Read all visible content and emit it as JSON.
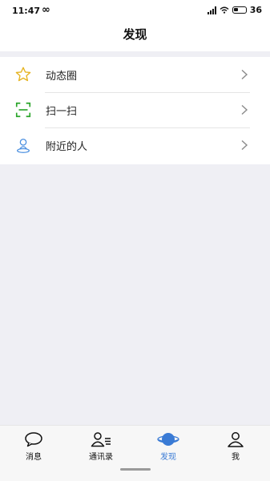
{
  "status_bar": {
    "time": "11:47",
    "link_icon": "infinity-icon",
    "battery": "36"
  },
  "header": {
    "title": "发现"
  },
  "menu": {
    "items": [
      {
        "label": "动态圈",
        "icon": "star-icon",
        "icon_color": "#e6b422"
      },
      {
        "label": "扫一扫",
        "icon": "scan-icon",
        "icon_color": "#2aa52a"
      },
      {
        "label": "附近的人",
        "icon": "person-location-icon",
        "icon_color": "#4a8fe0"
      }
    ]
  },
  "tabbar": {
    "active_color": "#3a7bd5",
    "tabs": [
      {
        "label": "消息",
        "icon": "chat-bubble-icon"
      },
      {
        "label": "通讯录",
        "icon": "contacts-icon"
      },
      {
        "label": "发现",
        "icon": "planet-icon",
        "active": true
      },
      {
        "label": "我",
        "icon": "user-icon"
      }
    ]
  }
}
